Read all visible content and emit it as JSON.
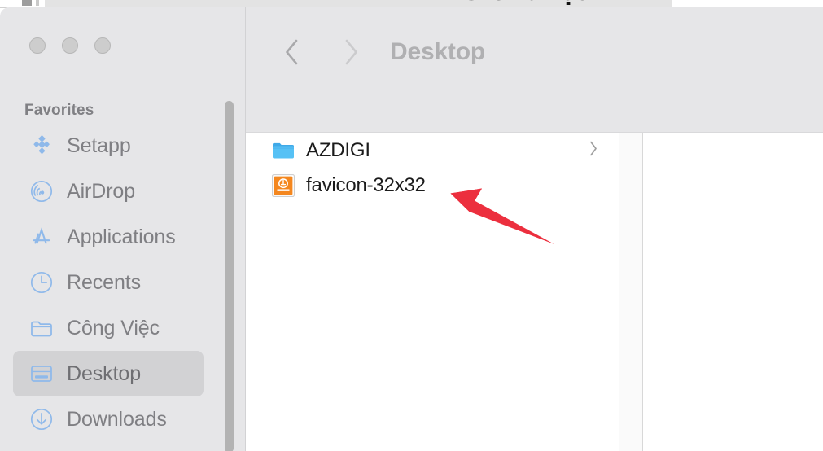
{
  "window": {
    "behind_clipped_text": "Giới thiệu",
    "traffic_lights": [
      {
        "name": "close",
        "color": "#cdcdcd"
      },
      {
        "name": "minimize",
        "color": "#cdcdcd"
      },
      {
        "name": "zoom",
        "color": "#cdcdcd"
      }
    ]
  },
  "toolbar": {
    "back_label": "Back",
    "forward_label": "Forward",
    "title": "Desktop"
  },
  "sidebar": {
    "section_title": "Favorites",
    "items": [
      {
        "label": "Setapp",
        "icon": "setapp-icon",
        "selected": false
      },
      {
        "label": "AirDrop",
        "icon": "airdrop-icon",
        "selected": false
      },
      {
        "label": "Applications",
        "icon": "applications-icon",
        "selected": false
      },
      {
        "label": "Recents",
        "icon": "clock-icon",
        "selected": false
      },
      {
        "label": "Công Việc",
        "icon": "folder-icon",
        "selected": false
      },
      {
        "label": "Desktop",
        "icon": "desktop-icon",
        "selected": true
      },
      {
        "label": "Downloads",
        "icon": "download-icon",
        "selected": false
      }
    ],
    "scrollbar": {
      "name": "sidebar-scrollbar"
    }
  },
  "file_list": {
    "items": [
      {
        "name": "AZDIGI",
        "icon": "blue-folder-icon",
        "has_disclosure": true
      },
      {
        "name": "favicon-32x32",
        "icon": "favicon-image-icon",
        "has_disclosure": false
      }
    ]
  },
  "annotation": {
    "name": "red-arrow-pointer",
    "color": "#ec2f3e"
  },
  "colors": {
    "sidebar_bg": "#e6e6e8",
    "toolbar_bg": "#e6e6e8",
    "content_bg": "#ffffff",
    "sidebar_icon_blue": "#8fb9ea",
    "selection_pill": "#d2d2d4",
    "folder_blue": "#4eb9f0",
    "favicon_orange": "#f4871f",
    "annotation_red": "#ec2f3e"
  }
}
